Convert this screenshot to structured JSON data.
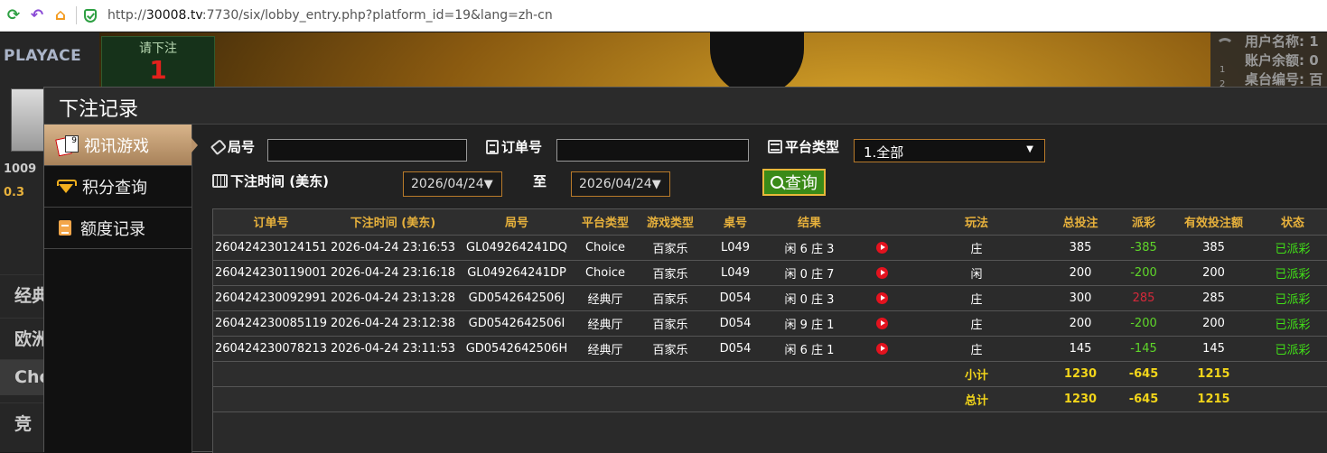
{
  "browser": {
    "reload_glyph": "⟳",
    "back_glyph": "↶",
    "home_glyph": "⌂",
    "url_prefix": "http://",
    "url_host": "30008.tv",
    "url_rest": ":7730/six/lobby_entry.php?platform_id=19&lang=zh-cn"
  },
  "background": {
    "logo": "PLAYACE",
    "bet_prompt": "请下注",
    "countdown": "1",
    "left_stats": [
      "1009",
      "0.3"
    ],
    "left_menu": [
      "经典",
      "欧洲",
      "Cho",
      "竞"
    ],
    "right_info": [
      "用户名称: 1",
      "账户余额: 0",
      "桌台编号: 百"
    ],
    "right_nums": [
      "1",
      "2"
    ]
  },
  "modal": {
    "title": "下注记录",
    "side_menu": [
      {
        "label": "视讯游戏",
        "icon": "cards-icon",
        "active": true
      },
      {
        "label": "积分查询",
        "icon": "diamond-icon",
        "active": false
      },
      {
        "label": "额度记录",
        "icon": "document-icon",
        "active": false
      }
    ]
  },
  "filters": {
    "round_label": "局号",
    "round_value": "",
    "order_label": "订单号",
    "order_value": "",
    "platform_label": "平台类型",
    "platform_selected": "1.全部",
    "time_label": "下注时间 (美东)",
    "date_from": "2026/04/24",
    "to_label": "至",
    "date_to": "2026/04/24",
    "query_label": "查询"
  },
  "table": {
    "headers": [
      "订单号",
      "下注时间 (美东)",
      "局号",
      "平台类型",
      "游戏类型",
      "桌号",
      "结果",
      "",
      "玩法",
      "总投注",
      "派彩",
      "有效投注额",
      "状态"
    ],
    "rows": [
      [
        "260424230124151",
        "2026-04-24 23:16:53",
        "GL049264241DQ",
        "Choice",
        "百家乐",
        "L049",
        "闲 6 庄 3",
        "play",
        "庄",
        "385",
        "-385",
        "385",
        "已派彩"
      ],
      [
        "260424230119001",
        "2026-04-24 23:16:18",
        "GL049264241DP",
        "Choice",
        "百家乐",
        "L049",
        "闲 0 庄 7",
        "play",
        "闲",
        "200",
        "-200",
        "200",
        "已派彩"
      ],
      [
        "260424230092991",
        "2026-04-24 23:13:28",
        "GD0542642506J",
        "经典厅",
        "百家乐",
        "D054",
        "闲 0 庄 3",
        "play",
        "庄",
        "300",
        "285",
        "285",
        "已派彩"
      ],
      [
        "260424230085119",
        "2026-04-24 23:12:38",
        "GD0542642506I",
        "经典厅",
        "百家乐",
        "D054",
        "闲 9 庄 1",
        "play",
        "庄",
        "200",
        "-200",
        "200",
        "已派彩"
      ],
      [
        "260424230078213",
        "2026-04-24 23:11:53",
        "GD0542642506H",
        "经典厅",
        "百家乐",
        "D054",
        "闲 6 庄 1",
        "play",
        "庄",
        "145",
        "-145",
        "145",
        "已派彩"
      ]
    ],
    "subtotal": {
      "label": "小计",
      "total_bet": "1230",
      "payout": "-645",
      "valid_bet": "1215"
    },
    "total": {
      "label": "总计",
      "total_bet": "1230",
      "payout": "-645",
      "valid_bet": "1215"
    }
  },
  "colors": {
    "header_gold": "#e7b13c",
    "payout_negative": "#5fd62a",
    "payout_positive": "#d4293a",
    "status_green": "#41e017",
    "sum_yellow": "#f2d51a"
  }
}
